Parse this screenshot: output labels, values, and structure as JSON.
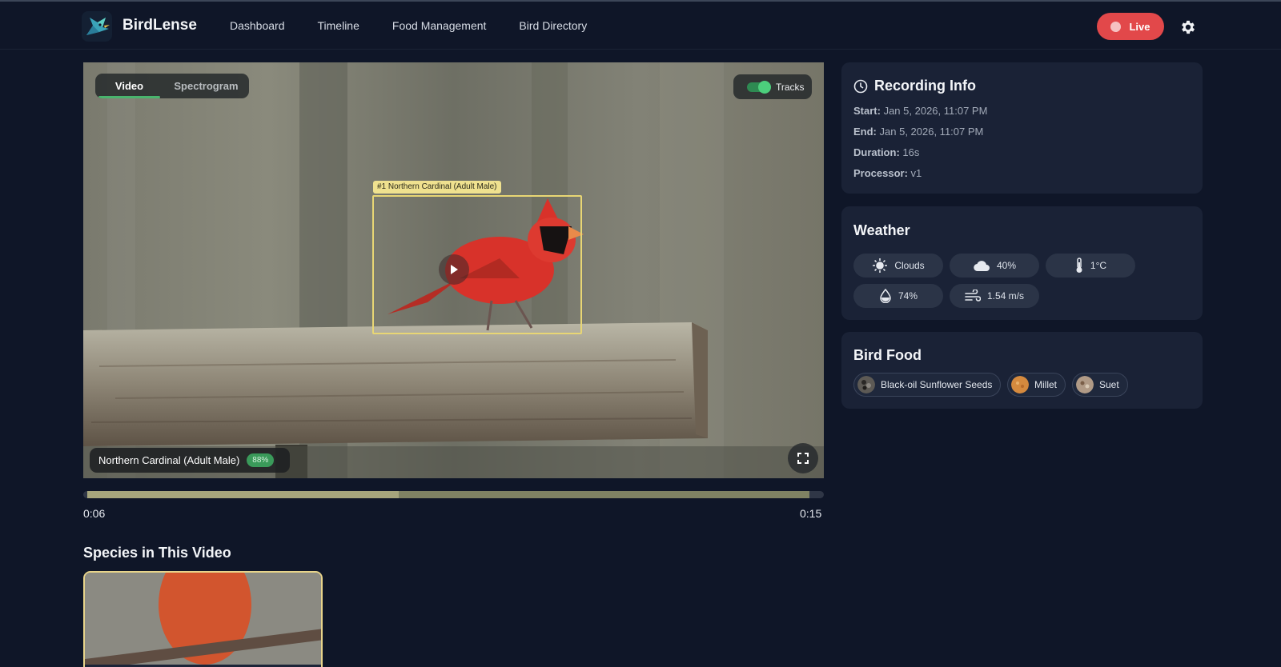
{
  "app": {
    "name": "BirdLense"
  },
  "nav": [
    {
      "label": "Dashboard"
    },
    {
      "label": "Timeline"
    },
    {
      "label": "Food Management"
    },
    {
      "label": "Bird Directory"
    }
  ],
  "header": {
    "live_label": "Live"
  },
  "video": {
    "tabs": [
      {
        "label": "Video",
        "active": true
      },
      {
        "label": "Spectrogram",
        "active": false
      }
    ],
    "tracks_label": "Tracks",
    "tracks_enabled": true,
    "detection_label": "#1 Northern Cardinal (Adult Male)",
    "species_name": "Northern Cardinal (Adult Male)",
    "confidence": "88%",
    "time_current": "0:06",
    "time_total": "0:15",
    "played_fraction": 0.42,
    "buffered_fraction": 0.98
  },
  "species_section": {
    "title": "Species in This Video"
  },
  "recording_info": {
    "title": "Recording Info",
    "rows": [
      {
        "key": "Start:",
        "value": "Jan 5, 2026, 11:07 PM"
      },
      {
        "key": "End:",
        "value": "Jan 5, 2026, 11:07 PM"
      },
      {
        "key": "Duration:",
        "value": "16s"
      },
      {
        "key": "Processor:",
        "value": "v1"
      }
    ]
  },
  "weather": {
    "title": "Weather",
    "conditions": "Clouds",
    "cloud_cover": "40%",
    "temperature": "1°C",
    "humidity": "74%",
    "wind": "1.54 m/s"
  },
  "bird_food": {
    "title": "Bird Food",
    "items": [
      {
        "label": "Black-oil Sunflower Seeds"
      },
      {
        "label": "Millet"
      },
      {
        "label": "Suet"
      }
    ]
  },
  "colors": {
    "background": "#0f1628",
    "card": "#1a2236",
    "live": "#e2484a",
    "accent_green": "#49b46d",
    "bbox": "#e8d674"
  }
}
